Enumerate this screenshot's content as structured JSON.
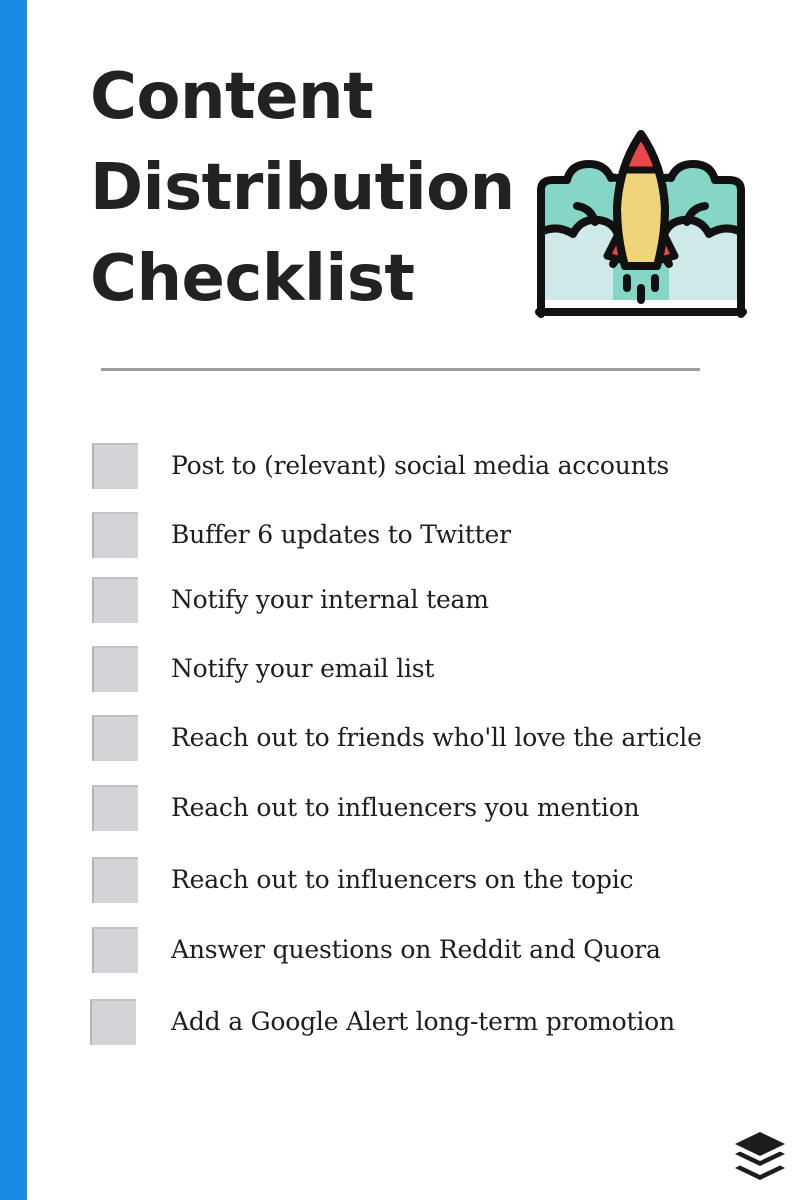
{
  "header": {
    "title_lines": [
      "Content",
      "Distribution",
      "Checklist"
    ]
  },
  "illustration": {
    "icon": "rocket-launch-icon",
    "colors": {
      "outline": "#111111",
      "rocket_body": "#efd47a",
      "rocket_tip": "#e8484a",
      "smoke_back": "#86d6c8",
      "smoke_front": "#cfe9ea"
    }
  },
  "checklist": {
    "items": [
      {
        "label": "Post to (relevant) social media accounts",
        "checked": false
      },
      {
        "label": "Buffer 6 updates to Twitter",
        "checked": false
      },
      {
        "label": "Notify your internal team",
        "checked": false
      },
      {
        "label": "Notify your email list",
        "checked": false
      },
      {
        "label": "Reach out to friends who'll love the article",
        "checked": false
      },
      {
        "label": "Reach out to influencers you mention",
        "checked": false
      },
      {
        "label": "Reach out to influencers on the topic",
        "checked": false
      },
      {
        "label": "Answer questions on Reddit and Quora",
        "checked": false
      },
      {
        "label": "Add a Google Alert long-term promotion",
        "checked": false
      }
    ]
  },
  "footer": {
    "logo": "buffer-logo-icon"
  },
  "colors": {
    "accent_bar": "#1a8be2",
    "title_text": "#222222",
    "divider": "#9c9ca4",
    "checkbox_fill": "#d4d4d8",
    "item_text": "#1e1e1e",
    "logo": "#1c1c1c"
  }
}
